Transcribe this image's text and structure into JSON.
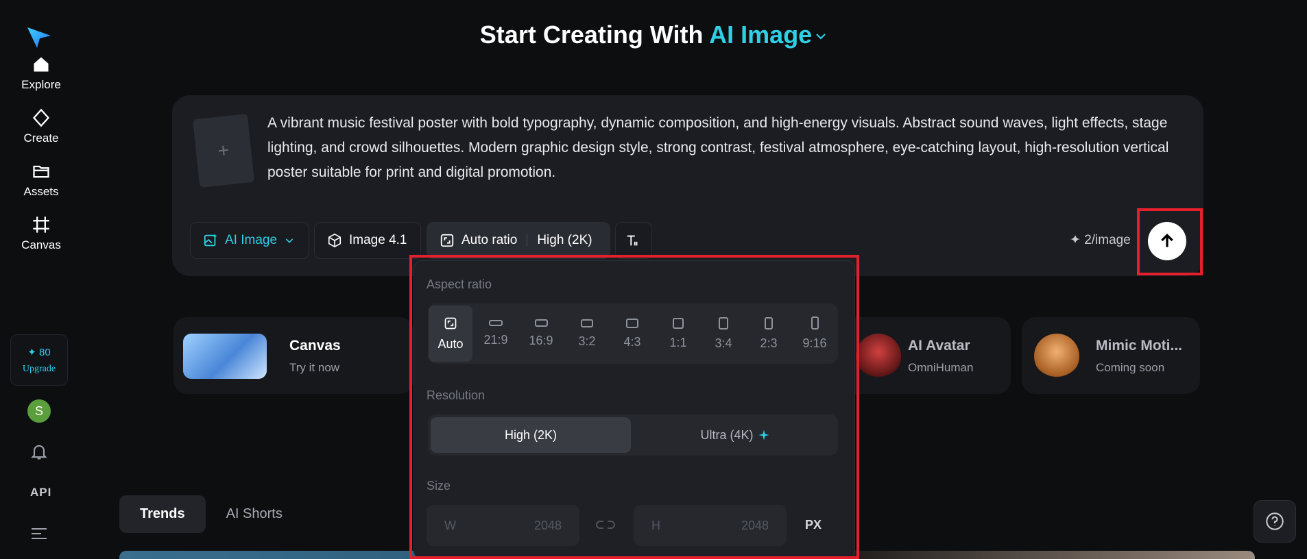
{
  "sidebar": {
    "items": [
      {
        "label": "Explore",
        "icon": "home-icon"
      },
      {
        "label": "Create",
        "icon": "diamond-icon"
      },
      {
        "label": "Assets",
        "icon": "folder-icon"
      },
      {
        "label": "Canvas",
        "icon": "crop-icon"
      }
    ],
    "credits_amount": "✦ 80",
    "upgrade_label": "Upgrade",
    "avatar_initial": "S",
    "api_label": "API"
  },
  "heading": {
    "prefix": "Start Creating With",
    "mode": "AI Image"
  },
  "prompt": {
    "text": "A vibrant music festival poster with bold typography, dynamic composition, and high-energy visuals. Abstract sound waves, light effects, stage lighting, and crowd silhouettes. Modern graphic design style, strong contrast, festival atmosphere, eye-catching layout, high-resolution vertical poster suitable for print and digital promotion.",
    "add_reference_symbol": "+"
  },
  "toolbar": {
    "mode_label": "AI Image",
    "model_label": "Image 4.1",
    "ratio_label": "Auto ratio",
    "quality_label": "High (2K)",
    "cost_label": "✦ 2/image"
  },
  "features": [
    {
      "title": "Canvas",
      "subtitle": "Try it now"
    },
    {
      "title": "AI Avatar",
      "subtitle": "OmniHuman"
    },
    {
      "title": "Mimic Moti...",
      "subtitle": "Coming soon"
    }
  ],
  "tabs": [
    {
      "label": "Trends",
      "active": true
    },
    {
      "label": "AI Shorts",
      "active": false
    }
  ],
  "popover": {
    "aspect_label": "Aspect ratio",
    "ratios": [
      "Auto",
      "21:9",
      "16:9",
      "3:2",
      "4:3",
      "1:1",
      "3:4",
      "2:3",
      "9:16"
    ],
    "selected_ratio": "Auto",
    "resolution_label": "Resolution",
    "resolutions": [
      "High (2K)",
      "Ultra (4K)"
    ],
    "selected_resolution": "High (2K)",
    "size_label": "Size",
    "width_prefix": "W",
    "width_value": "2048",
    "height_prefix": "H",
    "height_value": "2048",
    "unit": "PX"
  },
  "colors": {
    "accent": "#2fd0e6",
    "highlight": "#e3202c"
  }
}
